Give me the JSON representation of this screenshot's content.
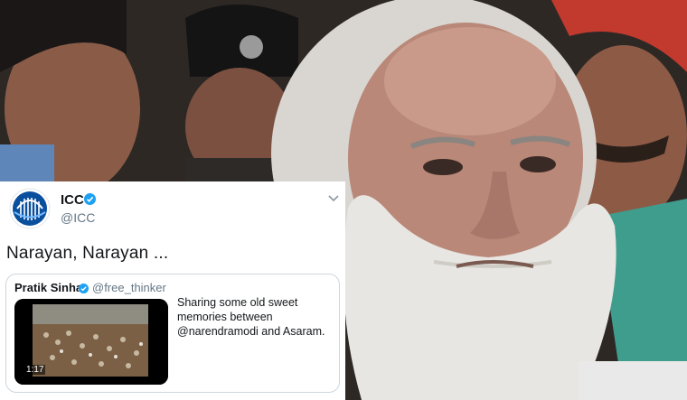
{
  "tweet": {
    "account_name": "ICC",
    "account_handle": "@ICC",
    "text": "Narayan, Narayan ...",
    "logo_icon": "icc-logo-icon",
    "accent_color": "#1da1f2"
  },
  "quoted_tweet": {
    "author_name": "Pratik Sinha",
    "author_handle": "@free_thinker",
    "text": "Sharing some old sweet memories between @narendramodi and Asaram.",
    "video_duration": "1:17"
  }
}
